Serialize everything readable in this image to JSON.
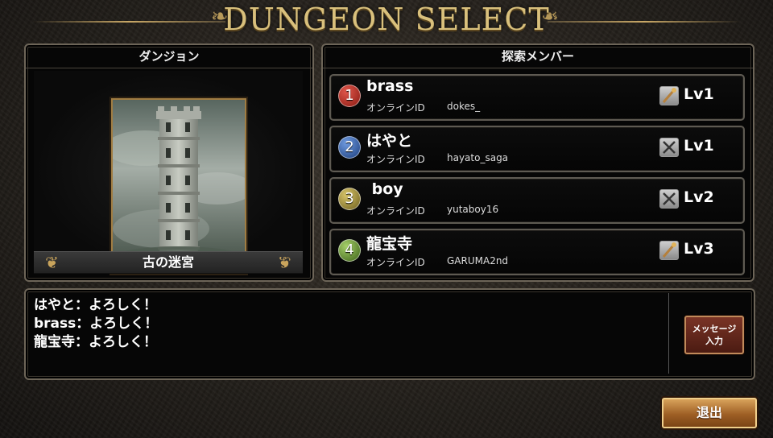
{
  "header": {
    "title": "DUNGEON SELECT"
  },
  "dungeon_panel": {
    "header": "ダンジョン",
    "dungeon_name": "古の迷宮"
  },
  "members_panel": {
    "header": "探索メンバー",
    "id_label": "オンラインID",
    "members": [
      {
        "number": "1",
        "name": "brass",
        "online_id": "dokes_",
        "weapon": "staff-icon",
        "level": "Lv1",
        "badge_color": "#b3261e"
      },
      {
        "number": "2",
        "name": "はやと",
        "online_id": "hayato_saga",
        "weapon": "swords-icon",
        "level": "Lv1",
        "badge_color": "#2e5fa8"
      },
      {
        "number": "3",
        "name": " boy",
        "online_id": "yutaboy16",
        "weapon": "swords-icon",
        "level": "Lv2",
        "badge_color": "#9a8a3a"
      },
      {
        "number": "4",
        "name": "龍宝寺",
        "online_id": "GARUMA2nd",
        "weapon": "staff-icon",
        "level": "Lv3",
        "badge_color": "#5f8a2e"
      }
    ]
  },
  "chat": {
    "messages": [
      "はやと：よろしく！",
      "brass：よろしく！",
      "龍宝寺：よろしく！"
    ],
    "message_button_line1": "メッセージ",
    "message_button_line2": "入力"
  },
  "footer": {
    "exit_label": "退出"
  }
}
